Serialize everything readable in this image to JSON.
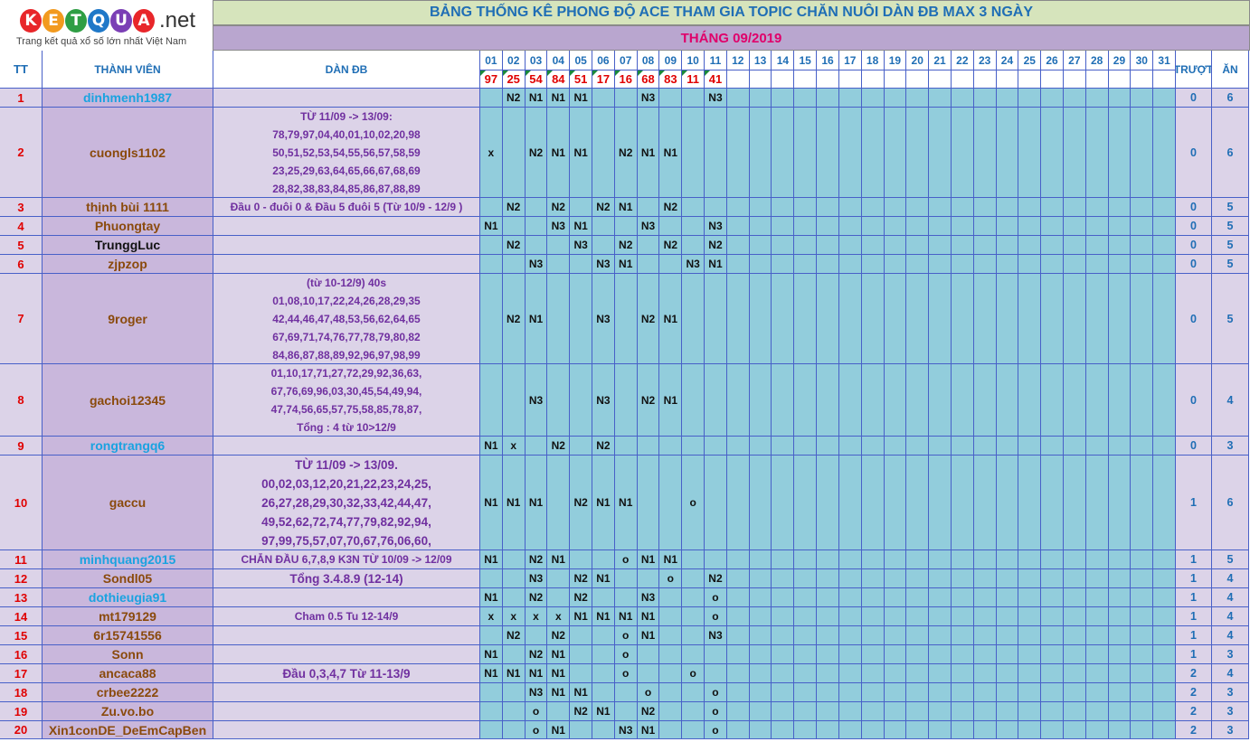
{
  "logo": {
    "letters": [
      "K",
      "E",
      "T",
      "Q",
      "U",
      "A"
    ],
    "net": ".net",
    "tagline": "Trang kết quả xổ số lớn nhất Việt Nam"
  },
  "title": "BẢNG THỐNG KÊ PHONG ĐỘ ACE THAM GIA TOPIC CHĂN NUÔI DÀN ĐB MAX 3 NGÀY",
  "month": "THÁNG 09/2019",
  "headers": {
    "tt": "TT",
    "member": "THÀNH VIÊN",
    "dan": "DÀN ĐB",
    "miss": "TRƯỢT",
    "win": "ĂN"
  },
  "days": [
    "01",
    "02",
    "03",
    "04",
    "05",
    "06",
    "07",
    "08",
    "09",
    "10",
    "11",
    "12",
    "13",
    "14",
    "15",
    "16",
    "17",
    "18",
    "19",
    "20",
    "21",
    "22",
    "23",
    "24",
    "25",
    "26",
    "27",
    "28",
    "29",
    "30",
    "31"
  ],
  "results": [
    "97",
    "25",
    "54",
    "84",
    "51",
    "17",
    "16",
    "68",
    "83",
    "11",
    "41"
  ],
  "colors": {
    "logo_letters": [
      "#e8262a",
      "#f29a1f",
      "#2f9e44",
      "#1f78c8",
      "#7b3fb5",
      "#e8262a"
    ]
  },
  "rows": [
    {
      "tt": "1",
      "member": "dinhmenh1987",
      "color": "blue",
      "dan": [],
      "marks": [
        "",
        "N2",
        "N1",
        "N1",
        "N1",
        "",
        "",
        "N3",
        "",
        "",
        "N3"
      ],
      "miss": "0",
      "win": "6"
    },
    {
      "tt": "2",
      "member": "cuongls1102",
      "color": "brown",
      "dan": [
        "TỪ 11/09 -> 13/09:",
        "78,79,97,04,40,01,10,02,20,98",
        "50,51,52,53,54,55,56,57,58,59",
        "23,25,29,63,64,65,66,67,68,69",
        "28,82,38,83,84,85,86,87,88,89"
      ],
      "marks": [
        "x",
        "",
        "N2",
        "N1",
        "N1",
        "",
        "N2",
        "N1",
        "N1",
        "",
        ""
      ],
      "miss": "0",
      "win": "6"
    },
    {
      "tt": "3",
      "member": "thịnh bùi 1111",
      "color": "brown",
      "dan": [
        "Đầu 0 - đuôi 0 & Đầu 5 đuôi 5 (Từ 10/9 - 12/9 )"
      ],
      "marks": [
        "",
        "N2",
        "",
        "N2",
        "",
        "N2",
        "N1",
        "",
        "N2",
        "",
        ""
      ],
      "miss": "0",
      "win": "5"
    },
    {
      "tt": "4",
      "member": "Phuongtay",
      "color": "brown",
      "dan": [],
      "marks": [
        "N1",
        "",
        "",
        "N3",
        "N1",
        "",
        "",
        "N3",
        "",
        "",
        "N3"
      ],
      "miss": "0",
      "win": "5"
    },
    {
      "tt": "5",
      "member": "TrunggLuc",
      "color": "black",
      "dan": [],
      "marks": [
        "",
        "N2",
        "",
        "",
        "N3",
        "",
        "N2",
        "",
        "N2",
        "",
        "N2"
      ],
      "miss": "0",
      "win": "5"
    },
    {
      "tt": "6",
      "member": "zjpzop",
      "color": "brown",
      "dan": [],
      "marks": [
        "",
        "",
        "N3",
        "",
        "",
        "N3",
        "N1",
        "",
        "",
        "N3",
        "N1"
      ],
      "miss": "0",
      "win": "5"
    },
    {
      "tt": "7",
      "member": "9roger",
      "color": "brown",
      "dan": [
        "(từ 10-12/9) 40s",
        "01,08,10,17,22,24,26,28,29,35",
        "42,44,46,47,48,53,56,62,64,65",
        "67,69,71,74,76,77,78,79,80,82",
        "84,86,87,88,89,92,96,97,98,99"
      ],
      "marks": [
        "",
        "N2",
        "N1",
        "",
        "",
        "N3",
        "",
        "N2",
        "N1",
        "",
        ""
      ],
      "miss": "0",
      "win": "5"
    },
    {
      "tt": "8",
      "member": "gachoi12345",
      "color": "brown",
      "dan": [
        "01,10,17,71,27,72,29,92,36,63,",
        "67,76,69,96,03,30,45,54,49,94,",
        "47,74,56,65,57,75,58,85,78,87,",
        "Tổng : 4 từ 10>12/9"
      ],
      "marks": [
        "",
        "",
        "N3",
        "",
        "",
        "N3",
        "",
        "N2",
        "N1",
        "",
        ""
      ],
      "miss": "0",
      "win": "4"
    },
    {
      "tt": "9",
      "member": "rongtrangq6",
      "color": "blue",
      "dan": [],
      "marks": [
        "N1",
        "x",
        "",
        "N2",
        "",
        "N2",
        "",
        "",
        "",
        "",
        ""
      ],
      "miss": "0",
      "win": "3"
    },
    {
      "tt": "10",
      "member": "gaccu",
      "color": "brown",
      "dan": [
        "TỪ 11/09 -> 13/09.",
        "00,02,03,12,20,21,22,23,24,25,",
        "26,27,28,29,30,32,33,42,44,47,",
        "49,52,62,72,74,77,79,82,92,94,",
        "97,99,75,57,07,70,67,76,06,60,"
      ],
      "big": true,
      "marks": [
        "N1",
        "N1",
        "N1",
        "",
        "N2",
        "N1",
        "N1",
        "",
        "",
        "o",
        ""
      ],
      "miss": "1",
      "win": "6"
    },
    {
      "tt": "11",
      "member": "minhquang2015",
      "color": "blue",
      "dan": [
        "CHẴN ĐẦU 6,7,8,9 K3N TỪ 10/09 -> 12/09"
      ],
      "marks": [
        "N1",
        "",
        "N2",
        "N1",
        "",
        "",
        "o",
        "N1",
        "N1",
        "",
        ""
      ],
      "miss": "1",
      "win": "5"
    },
    {
      "tt": "12",
      "member": "Sondl05",
      "color": "brown",
      "dan": [
        "Tổng 3.4.8.9 (12-14)"
      ],
      "big": true,
      "marks": [
        "",
        "",
        "N3",
        "",
        "N2",
        "N1",
        "",
        "",
        "o",
        "",
        "N2"
      ],
      "miss": "1",
      "win": "4"
    },
    {
      "tt": "13",
      "member": "dothieugia91",
      "color": "blue",
      "dan": [],
      "marks": [
        "N1",
        "",
        "N2",
        "",
        "N2",
        "",
        "",
        "N3",
        "",
        "",
        "o"
      ],
      "miss": "1",
      "win": "4"
    },
    {
      "tt": "14",
      "member": "mt179129",
      "color": "brown",
      "dan": [
        "Cham 0.5 Tu 12-14/9"
      ],
      "marks": [
        "x",
        "x",
        "x",
        "x",
        "N1",
        "N1",
        "N1",
        "N1",
        "",
        "",
        "o"
      ],
      "miss": "1",
      "win": "4"
    },
    {
      "tt": "15",
      "member": "6r15741556",
      "color": "brown",
      "dan": [],
      "marks": [
        "",
        "N2",
        "",
        "N2",
        "",
        "",
        "o",
        "N1",
        "",
        "",
        "N3"
      ],
      "miss": "1",
      "win": "4"
    },
    {
      "tt": "16",
      "member": "Sonn",
      "color": "brown",
      "dan": [],
      "marks": [
        "N1",
        "",
        "N2",
        "N1",
        "",
        "",
        "o",
        "",
        "",
        "",
        ""
      ],
      "miss": "1",
      "win": "3"
    },
    {
      "tt": "17",
      "member": "ancaca88",
      "color": "brown",
      "dan": [
        "Đầu 0,3,4,7 Từ 11-13/9"
      ],
      "big": true,
      "marks": [
        "N1",
        "N1",
        "N1",
        "N1",
        "",
        "",
        "o",
        "",
        "",
        "o",
        ""
      ],
      "miss": "2",
      "win": "4"
    },
    {
      "tt": "18",
      "member": "crbee2222",
      "color": "brown",
      "dan": [],
      "marks": [
        "",
        "",
        "N3",
        "N1",
        "N1",
        "",
        "",
        "o",
        "",
        "",
        "o"
      ],
      "miss": "2",
      "win": "3"
    },
    {
      "tt": "19",
      "member": "Zu.vo.bo",
      "color": "brown",
      "dan": [],
      "marks": [
        "",
        "",
        "o",
        "",
        "N2",
        "N1",
        "",
        "N2",
        "",
        "",
        "o"
      ],
      "miss": "2",
      "win": "3"
    },
    {
      "tt": "20",
      "member": "Xin1conDE_DeEmCapBen",
      "color": "brown",
      "dan": [],
      "marks": [
        "",
        "",
        "o",
        "N1",
        "",
        "",
        "N3",
        "N1",
        "",
        "",
        "o"
      ],
      "miss": "2",
      "win": "3"
    }
  ]
}
